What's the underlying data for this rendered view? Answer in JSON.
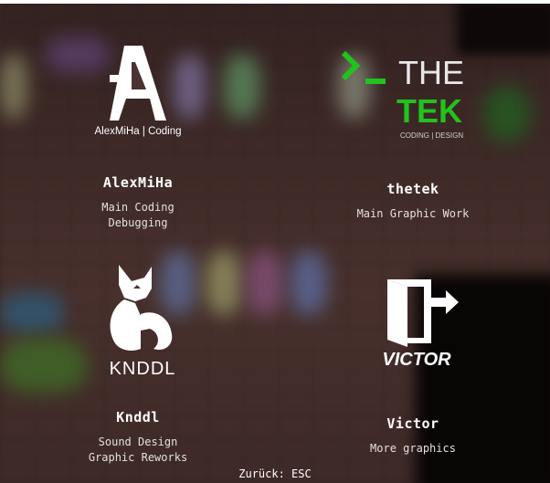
{
  "credits": [
    {
      "logo_text": "AlexMiHa | Coding",
      "name": "AlexMiHa",
      "roles": [
        "Main Coding",
        "Debugging"
      ]
    },
    {
      "logo_title_1": "THE",
      "logo_title_2": "TEK",
      "logo_sub": "CODING | DESIGN",
      "name": "thetek",
      "roles": [
        "Main Graphic Work"
      ]
    },
    {
      "logo_text": "KNDDL",
      "name": "Knddl",
      "roles": [
        "Sound Design",
        "Graphic Reworks"
      ]
    },
    {
      "logo_text": "VICTOR",
      "name": "Victor",
      "roles": [
        "More graphics"
      ]
    }
  ],
  "back_hint": "Zurück: ESC",
  "colors": {
    "tek_green": "#22c21f",
    "text": "#ffffff"
  }
}
